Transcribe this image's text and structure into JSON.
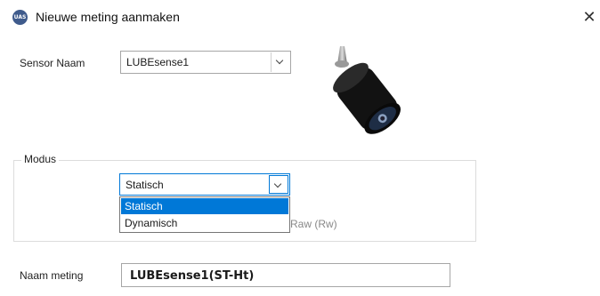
{
  "window": {
    "title": "Nieuwe meting aanmaken",
    "app_icon": "UAS logo",
    "close_icon": "close-icon"
  },
  "sensor": {
    "label": "Sensor Naam",
    "selected": "LUBEsense1",
    "image": "sensor-device"
  },
  "modus": {
    "legend": "Modus",
    "selected": "Statisch",
    "options": [
      "Statisch",
      "Dynamisch"
    ],
    "partial_behind_text": "Raw (Rw)"
  },
  "naam_meting": {
    "label": "Naam meting",
    "value": "LUBEsense1(ST-Ht)"
  },
  "colors": {
    "selection": "#0078d7",
    "border": "#a6a6a6"
  }
}
